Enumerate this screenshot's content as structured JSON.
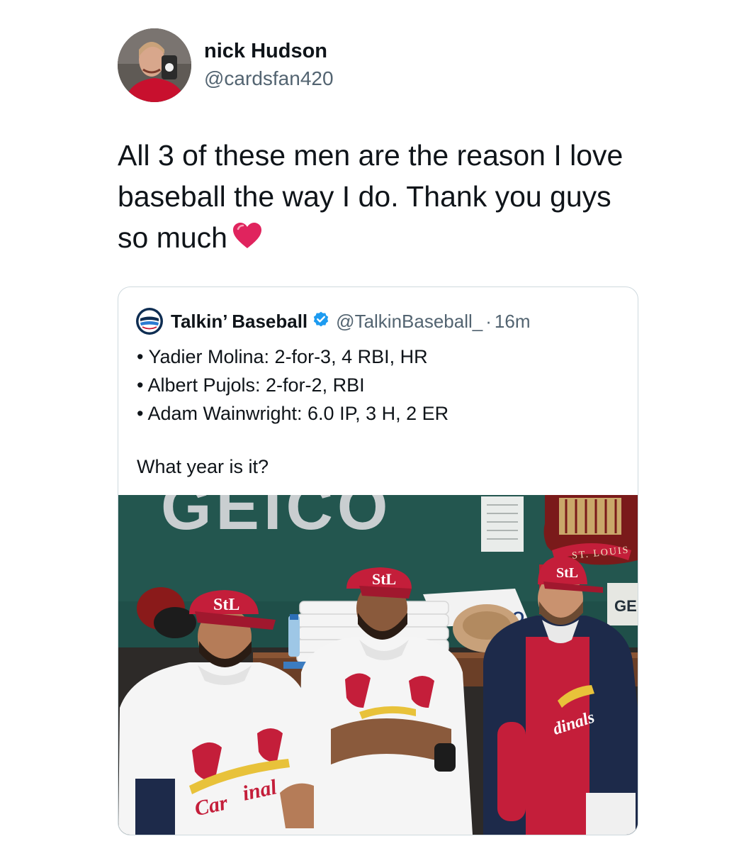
{
  "tweet": {
    "display_name": "nick Hudson",
    "handle": "@cardsfan420",
    "text": "All 3 of these men are the reason I love baseball the way I do. Thank you guys so much",
    "emoji": "red-heart"
  },
  "quoted_tweet": {
    "display_name": "Talkin’ Baseball",
    "verified": true,
    "handle": "@TalkinBaseball_",
    "separator": "·",
    "time": "16m",
    "lines": [
      "• Yadier Molina: 2-for-3, 4 RBI, HR",
      "• Albert Pujols: 2-for-2, RBI",
      "• Adam Wainwright: 6.0 IP, 3 H, 2 ER"
    ],
    "question": "What year is it?",
    "photo": {
      "signage": [
        "GEICO",
        "ST. LOUIS",
        "GE",
        "CO"
      ],
      "jersey_script": [
        "Car",
        "inal",
        "dinals"
      ]
    }
  },
  "colors": {
    "text_primary": "#0f1419",
    "text_secondary": "#536471",
    "verified_blue": "#1d9bf0",
    "cardinals_red": "#c41e3a",
    "dugout_green": "#1f4f49"
  },
  "icons": [
    "verified-badge-icon",
    "talkin-baseball-logo-icon",
    "heart-emoji-icon"
  ]
}
